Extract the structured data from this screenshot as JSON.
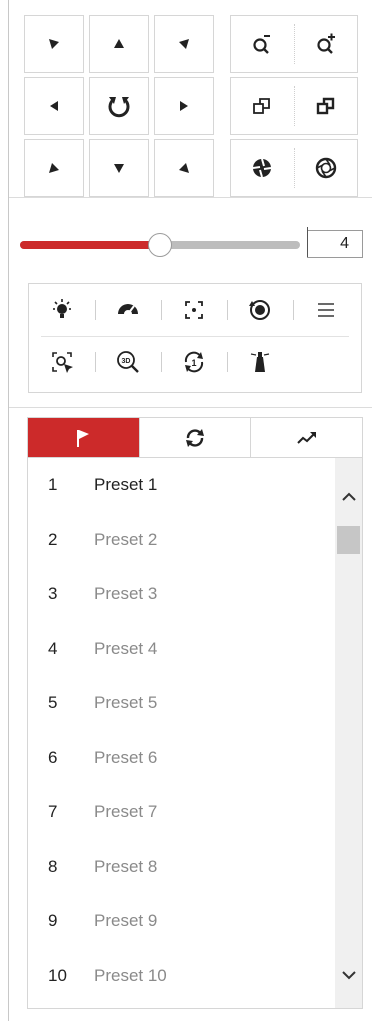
{
  "ptz": {
    "directions": [
      {
        "id": "up-left",
        "icon": "arrow-up-left-icon"
      },
      {
        "id": "up",
        "icon": "arrow-up-icon"
      },
      {
        "id": "up-right",
        "icon": "arrow-up-right-icon"
      },
      {
        "id": "left",
        "icon": "arrow-left-icon"
      },
      {
        "id": "auto-pan",
        "icon": "auto-pan-icon"
      },
      {
        "id": "right",
        "icon": "arrow-right-icon"
      },
      {
        "id": "down-left",
        "icon": "arrow-down-left-icon"
      },
      {
        "id": "down",
        "icon": "arrow-down-icon"
      },
      {
        "id": "down-right",
        "icon": "arrow-down-right-icon"
      }
    ],
    "pairs": [
      {
        "left": "zoom-out-icon",
        "right": "zoom-in-icon"
      },
      {
        "left": "focus-near-icon",
        "right": "focus-far-icon"
      },
      {
        "left": "iris-close-icon",
        "right": "iris-open-icon"
      }
    ]
  },
  "speed": {
    "value": "4",
    "fraction": 0.5
  },
  "aux_functions": {
    "row1": [
      "light-icon",
      "wiper-icon",
      "one-touch-focus-icon",
      "lens-initialization-icon",
      "menu-icon"
    ],
    "row2": [
      "manual-tracking-icon",
      "3d-zoom-icon",
      "one-touch-park-icon",
      "lighthouse-icon"
    ]
  },
  "tabs": [
    {
      "name": "preset",
      "icon": "flag-icon",
      "active": true
    },
    {
      "name": "patrol",
      "icon": "patrol-icon",
      "active": false
    },
    {
      "name": "pattern",
      "icon": "pattern-icon",
      "active": false
    }
  ],
  "presets": [
    {
      "num": "1",
      "name": "Preset 1"
    },
    {
      "num": "2",
      "name": "Preset 2"
    },
    {
      "num": "3",
      "name": "Preset 3"
    },
    {
      "num": "4",
      "name": "Preset 4"
    },
    {
      "num": "5",
      "name": "Preset 5"
    },
    {
      "num": "6",
      "name": "Preset 6"
    },
    {
      "num": "7",
      "name": "Preset 7"
    },
    {
      "num": "8",
      "name": "Preset 8"
    },
    {
      "num": "9",
      "name": "Preset 9"
    },
    {
      "num": "10",
      "name": "Preset 10"
    }
  ],
  "colors": {
    "accent": "#cc2a2a",
    "icon": "#222222"
  }
}
